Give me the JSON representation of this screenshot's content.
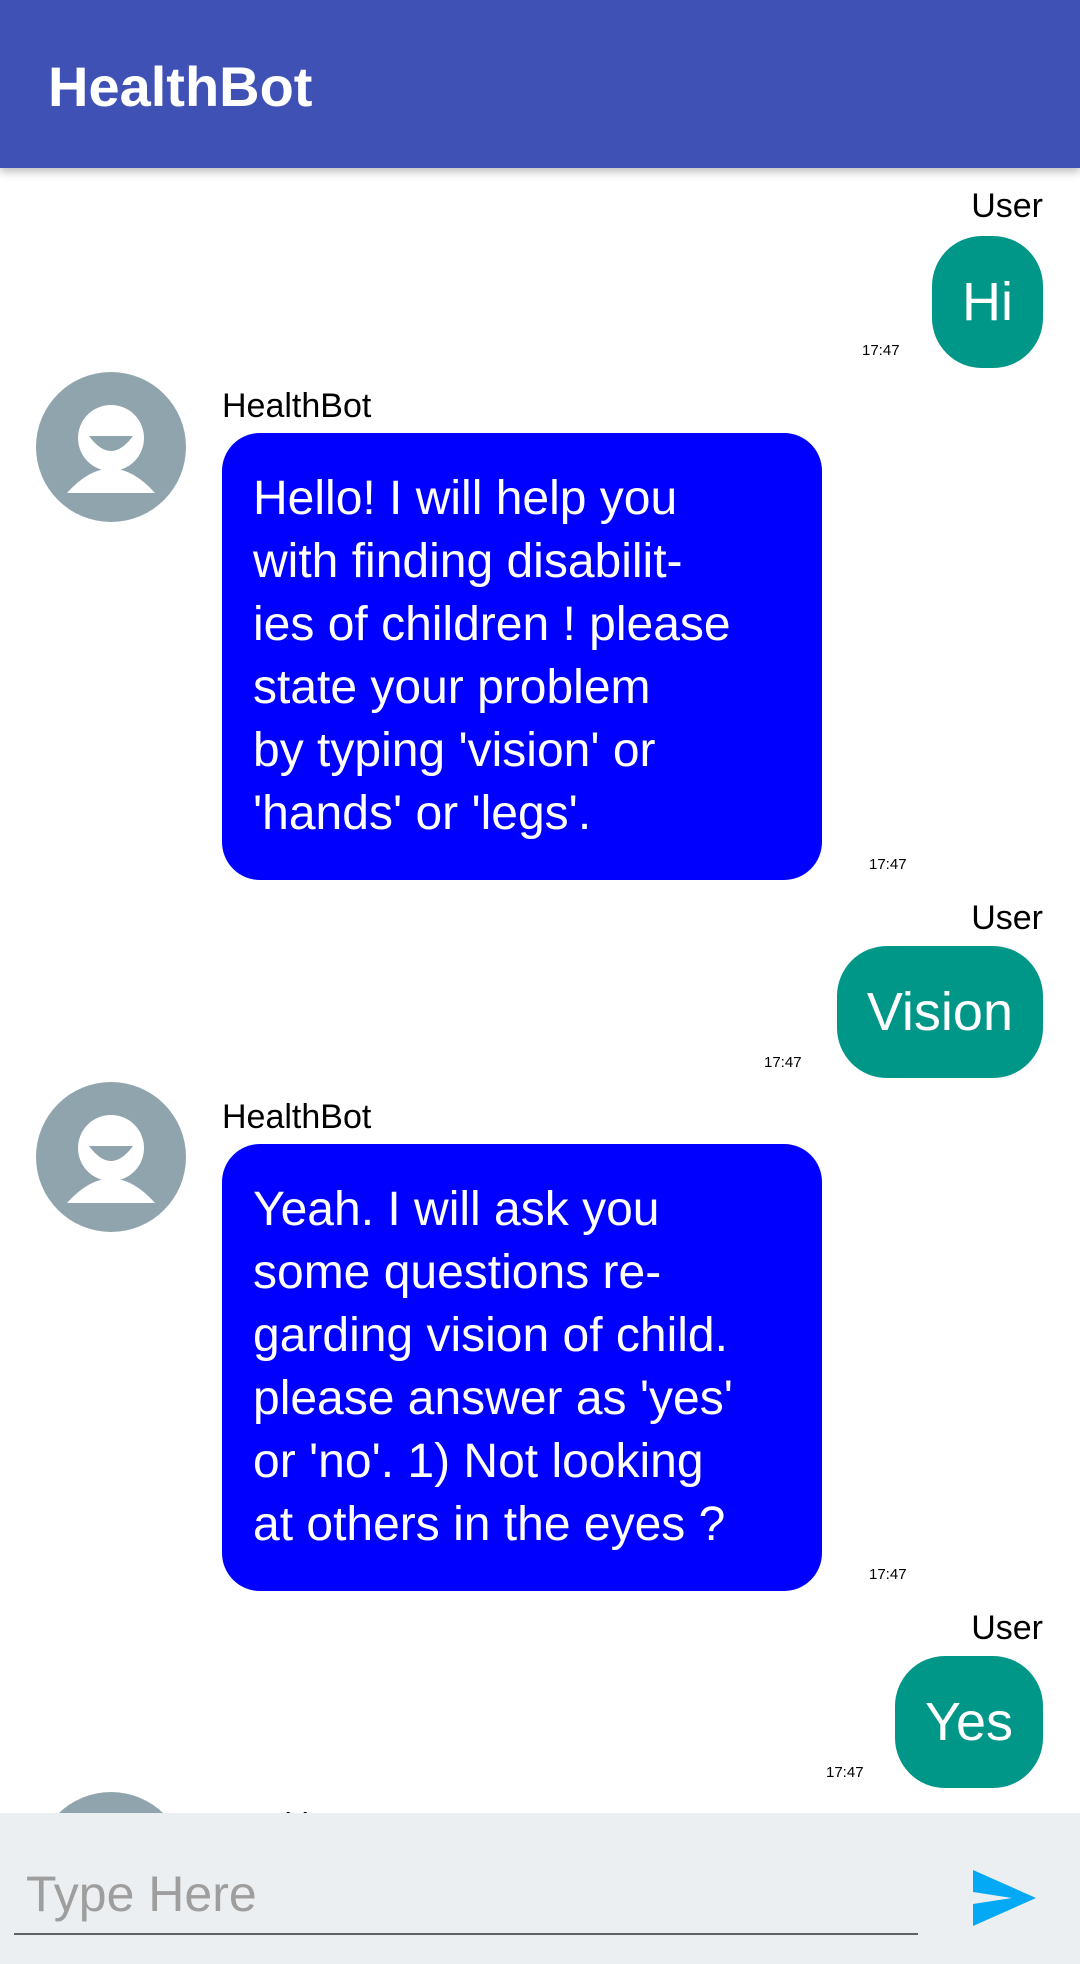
{
  "app": {
    "title": "HealthBot"
  },
  "messages": [
    {
      "sender": "User",
      "type": "user",
      "text": "Hi",
      "time": "17:47"
    },
    {
      "sender": "HealthBot",
      "type": "bot",
      "text": "Hello! I will help you\nwith finding disabilit-\nies of children ! please\nstate your problem\nby typing 'vision' or\n'hands' or 'legs'.",
      "time": "17:47"
    },
    {
      "sender": "User",
      "type": "user",
      "text": "Vision",
      "time": "17:47"
    },
    {
      "sender": "HealthBot",
      "type": "bot",
      "text": "Yeah. I will ask you\nsome questions re-\ngarding vision of child.\nplease answer as 'yes'\nor 'no'. 1) Not looking\nat others in the eyes ?",
      "time": "17:47"
    },
    {
      "sender": "User",
      "type": "user",
      "text": "Yes",
      "time": "17:47"
    }
  ],
  "input": {
    "placeholder": "Type Here",
    "value": ""
  },
  "icons": {
    "avatar": "person-avatar-icon",
    "send": "send-icon"
  },
  "colors": {
    "appbar": "#3f51b5",
    "user_bubble": "#009688",
    "bot_bubble": "#0000ff",
    "avatar": "#90a4ae",
    "send": "#03a9f4"
  }
}
